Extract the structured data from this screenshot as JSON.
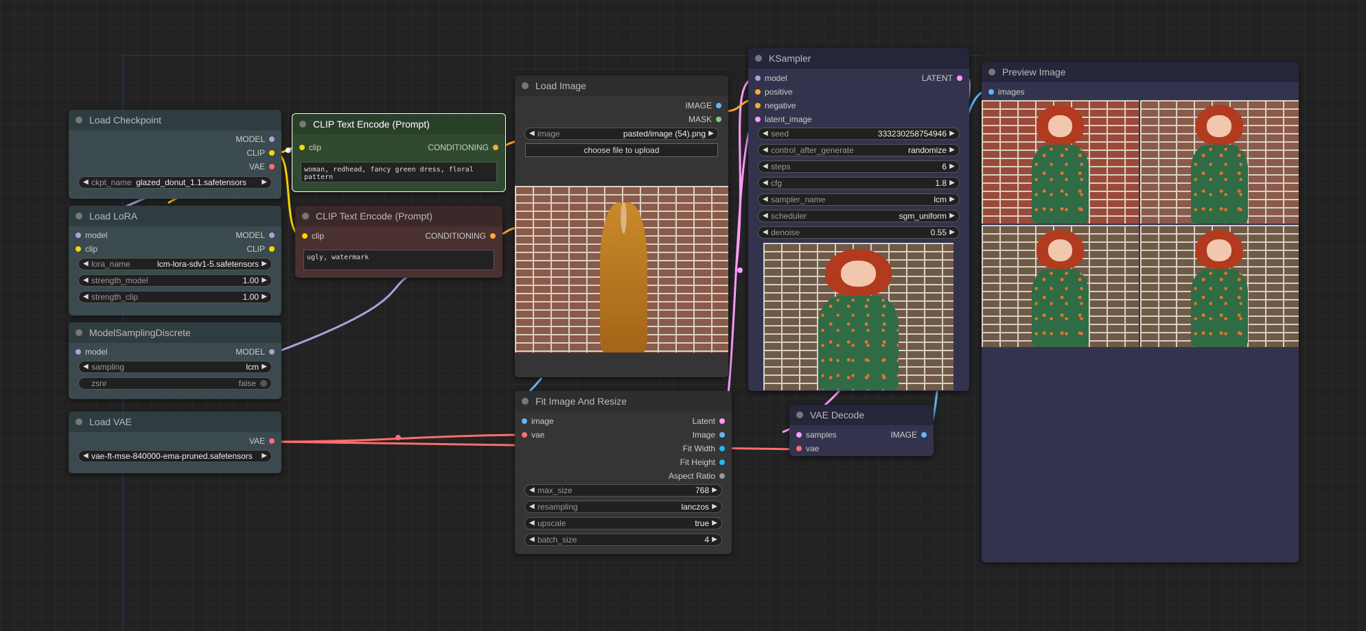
{
  "colors": {
    "model": "#b39ddb",
    "clip": "#ffd500",
    "vae": "#ff6e6e",
    "conditioning": "#ffa931",
    "image": "#64b5f6",
    "latent": "#ff9cf9",
    "mask": "#81c784",
    "int": "#29b6f6"
  },
  "load_checkpoint": {
    "title": "Load Checkpoint",
    "outputs": [
      "MODEL",
      "CLIP",
      "VAE"
    ],
    "ckpt_label": "ckpt_name",
    "ckpt_value": "glazed_donut_1.1.safetensors"
  },
  "load_lora": {
    "title": "Load LoRA",
    "inputs": [
      "model",
      "clip"
    ],
    "outputs": [
      "MODEL",
      "CLIP"
    ],
    "widgets": [
      {
        "label": "lora_name",
        "value": "lcm-lora-sdv1-5.safetensors"
      },
      {
        "label": "strength_model",
        "value": "1.00"
      },
      {
        "label": "strength_clip",
        "value": "1.00"
      }
    ]
  },
  "model_sampling": {
    "title": "ModelSamplingDiscrete",
    "input": "model",
    "output": "MODEL",
    "widgets": [
      {
        "label": "sampling",
        "value": "lcm"
      },
      {
        "label": "zsnr",
        "value": "false"
      }
    ]
  },
  "load_vae": {
    "title": "Load VAE",
    "output": "VAE",
    "widget_value": "vae-ft-mse-840000-ema-pruned.safetensors"
  },
  "clip_pos": {
    "title": "CLIP Text Encode (Prompt)",
    "input": "clip",
    "output": "CONDITIONING",
    "text": "woman, redhead, fancy green dress, floral pattern"
  },
  "clip_neg": {
    "title": "CLIP Text Encode (Prompt)",
    "input": "clip",
    "output": "CONDITIONING",
    "text": "ugly, watermark"
  },
  "load_image": {
    "title": "Load Image",
    "outputs": [
      "IMAGE",
      "MASK"
    ],
    "image_label": "image",
    "image_value": "pasted/image (54).png",
    "upload_label": "choose file to upload"
  },
  "fit_image": {
    "title": "Fit Image And Resize",
    "inputs": [
      "image",
      "vae"
    ],
    "outputs": [
      "Latent",
      "Image",
      "Fit Width",
      "Fit Height",
      "Aspect Ratio"
    ],
    "widgets": [
      {
        "label": "max_size",
        "value": "768"
      },
      {
        "label": "resampling",
        "value": "lanczos"
      },
      {
        "label": "upscale",
        "value": "true"
      },
      {
        "label": "batch_size",
        "value": "4"
      }
    ]
  },
  "ksampler": {
    "title": "KSampler",
    "inputs": [
      "model",
      "positive",
      "negative",
      "latent_image"
    ],
    "output": "LATENT",
    "widgets": [
      {
        "label": "seed",
        "value": "333230258754946"
      },
      {
        "label": "control_after_generate",
        "value": "randomize"
      },
      {
        "label": "steps",
        "value": "6"
      },
      {
        "label": "cfg",
        "value": "1.8"
      },
      {
        "label": "sampler_name",
        "value": "lcm"
      },
      {
        "label": "scheduler",
        "value": "sgm_uniform"
      },
      {
        "label": "denoise",
        "value": "0.55"
      }
    ]
  },
  "vae_decode": {
    "title": "VAE Decode",
    "inputs": [
      "samples",
      "vae"
    ],
    "output": "IMAGE"
  },
  "preview": {
    "title": "Preview Image",
    "input": "images"
  }
}
